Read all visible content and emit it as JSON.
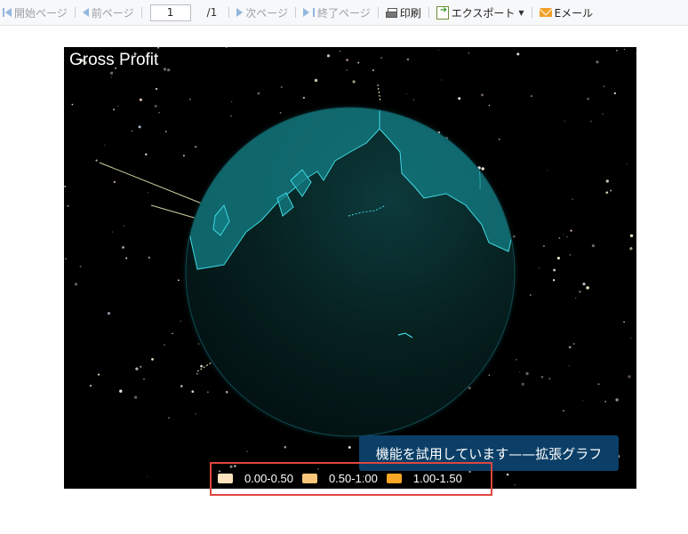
{
  "toolbar": {
    "first_page": "開始ページ",
    "prev_page": "前ページ",
    "page_number": "1",
    "total_pages": "/1",
    "next_page": "次ページ",
    "last_page": "終了ページ",
    "print": "印刷",
    "export": "エクスポート",
    "email": "Eメール"
  },
  "chart": {
    "title": "Gross Profit",
    "trial_banner": "機能を試用しています——拡張グラフ",
    "legend": [
      {
        "label": "0.00-0.50",
        "color": "#fde3bd"
      },
      {
        "label": "0.50-1.00",
        "color": "#fbc67a"
      },
      {
        "label": "1.00-1.50",
        "color": "#f8a625"
      }
    ],
    "colors": {
      "background": "#000000",
      "globe_ocean": "#041a1c",
      "land": "#137f86",
      "land_border": "#3fd9e4",
      "highlight_box": "#e0463f"
    }
  }
}
